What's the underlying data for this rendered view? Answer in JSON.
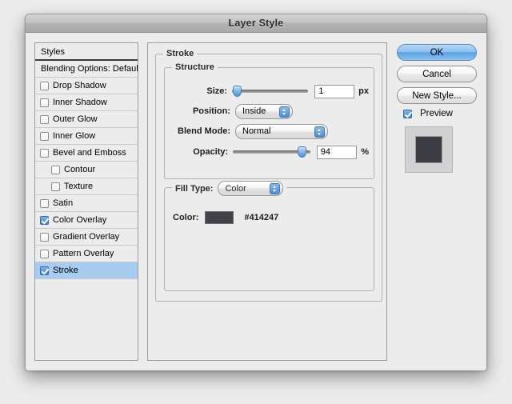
{
  "window": {
    "title": "Layer Style"
  },
  "sidebar": {
    "header": "Styles",
    "items": [
      {
        "label": "Blending Options: Default",
        "checkbox": false,
        "checked": false,
        "indent": false,
        "selected": false
      },
      {
        "label": "Drop Shadow",
        "checkbox": true,
        "checked": false,
        "indent": false,
        "selected": false
      },
      {
        "label": "Inner Shadow",
        "checkbox": true,
        "checked": false,
        "indent": false,
        "selected": false
      },
      {
        "label": "Outer Glow",
        "checkbox": true,
        "checked": false,
        "indent": false,
        "selected": false
      },
      {
        "label": "Inner Glow",
        "checkbox": true,
        "checked": false,
        "indent": false,
        "selected": false
      },
      {
        "label": "Bevel and Emboss",
        "checkbox": true,
        "checked": false,
        "indent": false,
        "selected": false
      },
      {
        "label": "Contour",
        "checkbox": true,
        "checked": false,
        "indent": true,
        "selected": false
      },
      {
        "label": "Texture",
        "checkbox": true,
        "checked": false,
        "indent": true,
        "selected": false
      },
      {
        "label": "Satin",
        "checkbox": true,
        "checked": false,
        "indent": false,
        "selected": false
      },
      {
        "label": "Color Overlay",
        "checkbox": true,
        "checked": true,
        "indent": false,
        "selected": false
      },
      {
        "label": "Gradient Overlay",
        "checkbox": true,
        "checked": false,
        "indent": false,
        "selected": false
      },
      {
        "label": "Pattern Overlay",
        "checkbox": true,
        "checked": false,
        "indent": false,
        "selected": false
      },
      {
        "label": "Stroke",
        "checkbox": true,
        "checked": true,
        "indent": false,
        "selected": true
      }
    ]
  },
  "main": {
    "stroke_legend": "Stroke",
    "structure_legend": "Structure",
    "size": {
      "label": "Size:",
      "value": "1",
      "unit": "px",
      "percent": 1
    },
    "position": {
      "label": "Position:",
      "value": "Inside"
    },
    "blend_mode": {
      "label": "Blend Mode:",
      "value": "Normal"
    },
    "opacity": {
      "label": "Opacity:",
      "value": "94",
      "unit": "%",
      "percent": 94
    },
    "fill_type": {
      "label": "Fill Type:",
      "value": "Color"
    },
    "color": {
      "label": "Color:",
      "hex": "#414247"
    }
  },
  "right": {
    "ok_label": "OK",
    "cancel_label": "Cancel",
    "new_style_label": "New Style...",
    "preview_label": "Preview",
    "preview_checked": true,
    "preview_bg": "#d2d2d2",
    "preview_fg": "#3b3d42"
  }
}
